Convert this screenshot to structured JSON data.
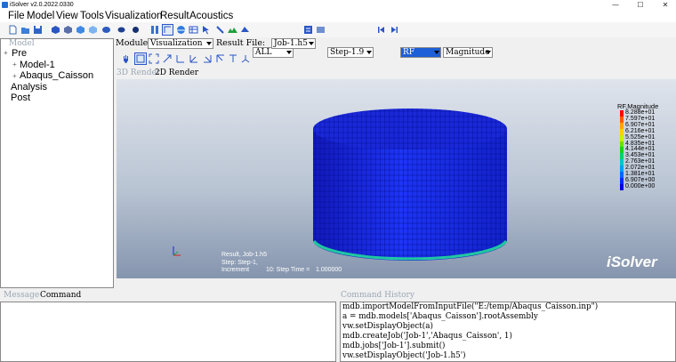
{
  "window": {
    "title": "iSolver v2.0.2022.0330",
    "controls": [
      "—",
      "☐",
      "✕"
    ]
  },
  "menu": [
    "File",
    "Model",
    "View",
    "Tools",
    "Visualization",
    "Result",
    "Acoustics"
  ],
  "toolbar": {
    "filter_select": "ALL",
    "step_select": "Step-1.9",
    "field_select": "RF",
    "component_select": "Magnitude"
  },
  "model_panel": {
    "header": "Model",
    "tree": [
      {
        "label": "Pre",
        "level": 0,
        "expander": "+"
      },
      {
        "label": "Model-1",
        "level": 1,
        "expander": "+"
      },
      {
        "label": "Abaqus_Caisson",
        "level": 1,
        "expander": "+"
      },
      {
        "label": "Analysis",
        "level": 0
      },
      {
        "label": "Post",
        "level": 0
      }
    ]
  },
  "module_bar": {
    "module_label": "Module:",
    "module_value": "Visualization",
    "result_file_label": "Result File:",
    "result_file_value": "Job-1.h5"
  },
  "render_tabs": {
    "tab_3d": "3D Render",
    "tab_2d": "2D Render"
  },
  "viewport": {
    "legend_title": "RF,Magnitude",
    "legend_values": [
      "8.288e+01",
      "7.597e+01",
      "6.907e+01",
      "6.216e+01",
      "5.525e+01",
      "4.835e+01",
      "4.144e+01",
      "3.453e+01",
      "2.763e+01",
      "2.072e+01",
      "1.381e+01",
      "6.907e+00",
      "0.000e+00"
    ],
    "legend_colors": [
      "#ff0000",
      "#ff5a00",
      "#ffa500",
      "#ffd000",
      "#c8f000",
      "#6ee000",
      "#1ad21a",
      "#00d270",
      "#00c8c8",
      "#00a0f0",
      "#0064ff",
      "#0028ff",
      "#0000dc"
    ],
    "info_result": "Result, Job-1.h5",
    "info_step": "Step: Step-1,",
    "info_increment_label": "Increment",
    "info_increment_value": "10: Step Time =",
    "info_step_time": "1.000000",
    "brand": "iSolver",
    "mesh_color": "#1a2df0"
  },
  "bottom": {
    "message_tab": "Message",
    "command_tab": "Command",
    "history_title": "Command History",
    "history_lines": [
      "mdb.importModelFromInputFile(\"E:/temp/Abaqus_Caisson.inp\")",
      "a = mdb.models['Abaqus_Caisson'].rootAssembly",
      "vw.setDisplayObject(a)",
      "mdb.createJob('Job-1','Abaqus_Caisson', 1)",
      "mdb.jobs['Job-1'].submit()",
      "vw.setDisplayObject('Job-1.h5')"
    ]
  }
}
